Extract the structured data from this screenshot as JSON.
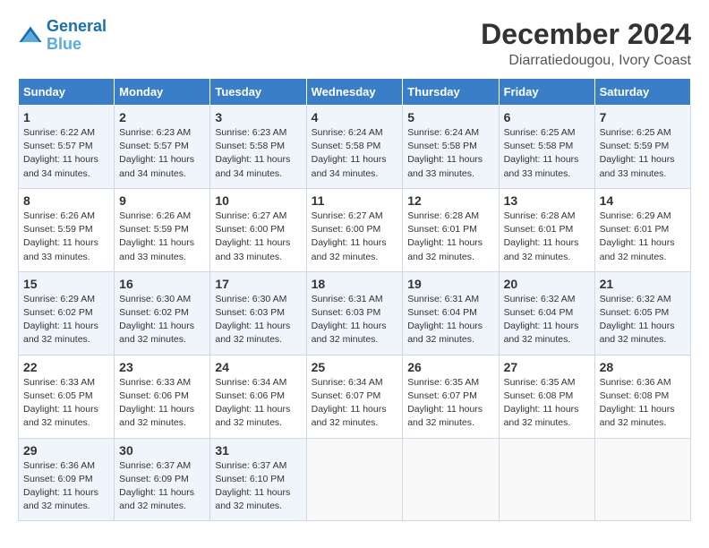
{
  "logo": {
    "line1": "General",
    "line2": "Blue"
  },
  "title": "December 2024",
  "subtitle": "Diarratiedougou, Ivory Coast",
  "days_header": [
    "Sunday",
    "Monday",
    "Tuesday",
    "Wednesday",
    "Thursday",
    "Friday",
    "Saturday"
  ],
  "weeks": [
    [
      {
        "day": "1",
        "info": "Sunrise: 6:22 AM\nSunset: 5:57 PM\nDaylight: 11 hours\nand 34 minutes."
      },
      {
        "day": "2",
        "info": "Sunrise: 6:23 AM\nSunset: 5:57 PM\nDaylight: 11 hours\nand 34 minutes."
      },
      {
        "day": "3",
        "info": "Sunrise: 6:23 AM\nSunset: 5:58 PM\nDaylight: 11 hours\nand 34 minutes."
      },
      {
        "day": "4",
        "info": "Sunrise: 6:24 AM\nSunset: 5:58 PM\nDaylight: 11 hours\nand 34 minutes."
      },
      {
        "day": "5",
        "info": "Sunrise: 6:24 AM\nSunset: 5:58 PM\nDaylight: 11 hours\nand 33 minutes."
      },
      {
        "day": "6",
        "info": "Sunrise: 6:25 AM\nSunset: 5:58 PM\nDaylight: 11 hours\nand 33 minutes."
      },
      {
        "day": "7",
        "info": "Sunrise: 6:25 AM\nSunset: 5:59 PM\nDaylight: 11 hours\nand 33 minutes."
      }
    ],
    [
      {
        "day": "8",
        "info": "Sunrise: 6:26 AM\nSunset: 5:59 PM\nDaylight: 11 hours\nand 33 minutes."
      },
      {
        "day": "9",
        "info": "Sunrise: 6:26 AM\nSunset: 5:59 PM\nDaylight: 11 hours\nand 33 minutes."
      },
      {
        "day": "10",
        "info": "Sunrise: 6:27 AM\nSunset: 6:00 PM\nDaylight: 11 hours\nand 33 minutes."
      },
      {
        "day": "11",
        "info": "Sunrise: 6:27 AM\nSunset: 6:00 PM\nDaylight: 11 hours\nand 32 minutes."
      },
      {
        "day": "12",
        "info": "Sunrise: 6:28 AM\nSunset: 6:01 PM\nDaylight: 11 hours\nand 32 minutes."
      },
      {
        "day": "13",
        "info": "Sunrise: 6:28 AM\nSunset: 6:01 PM\nDaylight: 11 hours\nand 32 minutes."
      },
      {
        "day": "14",
        "info": "Sunrise: 6:29 AM\nSunset: 6:01 PM\nDaylight: 11 hours\nand 32 minutes."
      }
    ],
    [
      {
        "day": "15",
        "info": "Sunrise: 6:29 AM\nSunset: 6:02 PM\nDaylight: 11 hours\nand 32 minutes."
      },
      {
        "day": "16",
        "info": "Sunrise: 6:30 AM\nSunset: 6:02 PM\nDaylight: 11 hours\nand 32 minutes."
      },
      {
        "day": "17",
        "info": "Sunrise: 6:30 AM\nSunset: 6:03 PM\nDaylight: 11 hours\nand 32 minutes."
      },
      {
        "day": "18",
        "info": "Sunrise: 6:31 AM\nSunset: 6:03 PM\nDaylight: 11 hours\nand 32 minutes."
      },
      {
        "day": "19",
        "info": "Sunrise: 6:31 AM\nSunset: 6:04 PM\nDaylight: 11 hours\nand 32 minutes."
      },
      {
        "day": "20",
        "info": "Sunrise: 6:32 AM\nSunset: 6:04 PM\nDaylight: 11 hours\nand 32 minutes."
      },
      {
        "day": "21",
        "info": "Sunrise: 6:32 AM\nSunset: 6:05 PM\nDaylight: 11 hours\nand 32 minutes."
      }
    ],
    [
      {
        "day": "22",
        "info": "Sunrise: 6:33 AM\nSunset: 6:05 PM\nDaylight: 11 hours\nand 32 minutes."
      },
      {
        "day": "23",
        "info": "Sunrise: 6:33 AM\nSunset: 6:06 PM\nDaylight: 11 hours\nand 32 minutes."
      },
      {
        "day": "24",
        "info": "Sunrise: 6:34 AM\nSunset: 6:06 PM\nDaylight: 11 hours\nand 32 minutes."
      },
      {
        "day": "25",
        "info": "Sunrise: 6:34 AM\nSunset: 6:07 PM\nDaylight: 11 hours\nand 32 minutes."
      },
      {
        "day": "26",
        "info": "Sunrise: 6:35 AM\nSunset: 6:07 PM\nDaylight: 11 hours\nand 32 minutes."
      },
      {
        "day": "27",
        "info": "Sunrise: 6:35 AM\nSunset: 6:08 PM\nDaylight: 11 hours\nand 32 minutes."
      },
      {
        "day": "28",
        "info": "Sunrise: 6:36 AM\nSunset: 6:08 PM\nDaylight: 11 hours\nand 32 minutes."
      }
    ],
    [
      {
        "day": "29",
        "info": "Sunrise: 6:36 AM\nSunset: 6:09 PM\nDaylight: 11 hours\nand 32 minutes."
      },
      {
        "day": "30",
        "info": "Sunrise: 6:37 AM\nSunset: 6:09 PM\nDaylight: 11 hours\nand 32 minutes."
      },
      {
        "day": "31",
        "info": "Sunrise: 6:37 AM\nSunset: 6:10 PM\nDaylight: 11 hours\nand 32 minutes."
      },
      {
        "day": "",
        "info": ""
      },
      {
        "day": "",
        "info": ""
      },
      {
        "day": "",
        "info": ""
      },
      {
        "day": "",
        "info": ""
      }
    ]
  ]
}
